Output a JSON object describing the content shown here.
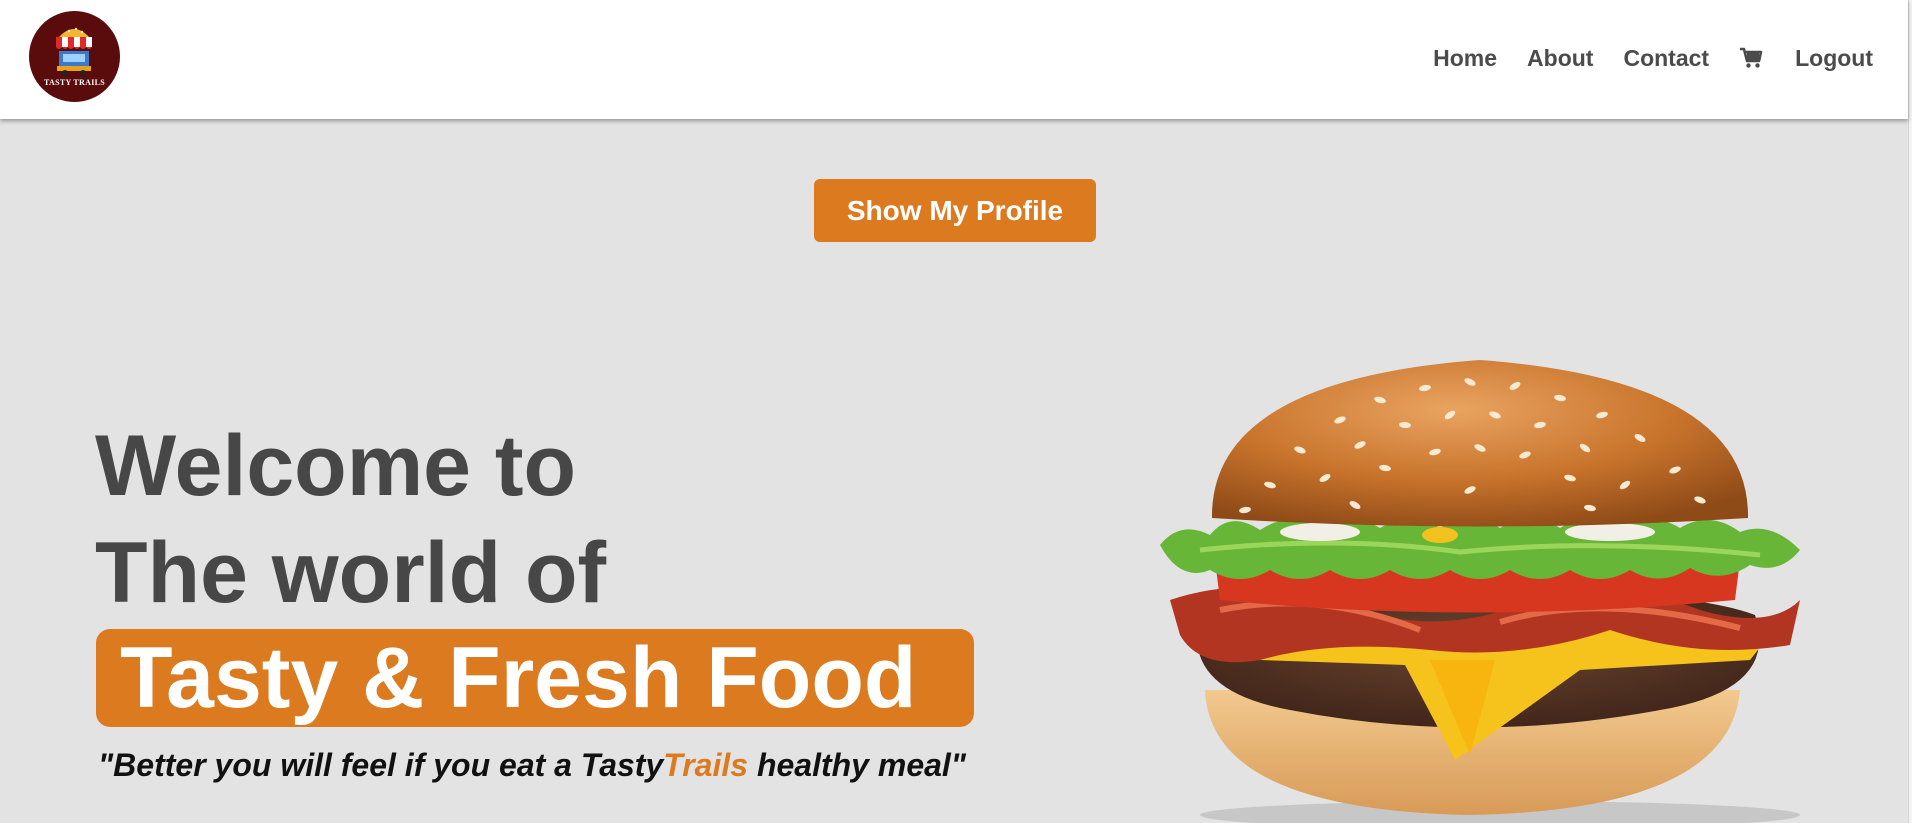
{
  "brand": {
    "name": "TASTY TRAILS",
    "logo_bg": "#5a0c0c"
  },
  "nav": {
    "items": [
      {
        "label": "Home"
      },
      {
        "label": "About"
      },
      {
        "label": "Contact"
      }
    ],
    "cart_icon": "shopping-cart-icon",
    "logout_label": "Logout"
  },
  "profile_button": {
    "label": "Show My Profile"
  },
  "hero": {
    "line1": "Welcome to",
    "line2": "The world of",
    "highlight": "Tasty & Fresh Food",
    "tagline_prefix": "\"Better you will feel if you eat a Tasty",
    "tagline_accent": "Trails",
    "tagline_suffix": " healthy meal\"",
    "image": "burger-image"
  },
  "colors": {
    "accent": "#db7a1f",
    "background": "#e3e3e3",
    "nav_text": "#4b4b4b",
    "heading": "#474747"
  }
}
